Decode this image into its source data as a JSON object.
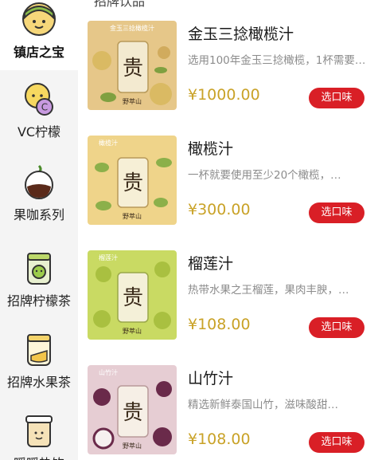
{
  "top_partial_text": "招牌饮品",
  "sidebar": {
    "items": [
      {
        "label": "镇店之宝",
        "active": true
      },
      {
        "label": "VC柠檬",
        "active": false
      },
      {
        "label": "果咖系列",
        "active": false
      },
      {
        "label": "招牌柠檬茶",
        "active": false
      },
      {
        "label": "招牌水果茶",
        "active": false
      },
      {
        "label": "暖暖热饮",
        "active": false
      }
    ]
  },
  "products": [
    {
      "name": "金玉三捻橄榄汁",
      "desc": "选用100年金玉三捻橄榄，1杯需要使用…",
      "price": "¥1000.00",
      "button": "选口味",
      "thumb_tag": "金玉三捻橄榄汁",
      "thumb_char": "贵",
      "thumb_brand": "野萃山",
      "thumb_color": "#e6c789"
    },
    {
      "name": "橄榄汁",
      "desc": "一杯就要使用至少20个橄榄，…",
      "price": "¥300.00",
      "button": "选口味",
      "thumb_tag": "橄榄汁",
      "thumb_char": "贵",
      "thumb_brand": "野萃山",
      "thumb_color": "#efd48a"
    },
    {
      "name": "榴莲汁",
      "desc": "热带水果之王榴莲，果肉丰腴，…",
      "price": "¥108.00",
      "button": "选口味",
      "thumb_tag": "榴莲汁",
      "thumb_char": "贵",
      "thumb_brand": "野萃山",
      "thumb_color": "#c9da63"
    },
    {
      "name": "山竹汁",
      "desc": "精选新鲜泰国山竹，滋味酸甜…",
      "price": "¥108.00",
      "button": "选口味",
      "thumb_tag": "山竹汁",
      "thumb_char": "贵",
      "thumb_brand": "野萃山",
      "thumb_color": "#e6cdd3"
    }
  ],
  "colors": {
    "accent_button": "#d91f26",
    "price": "#c9a227",
    "sidebar_bg": "#f4f4f4"
  }
}
